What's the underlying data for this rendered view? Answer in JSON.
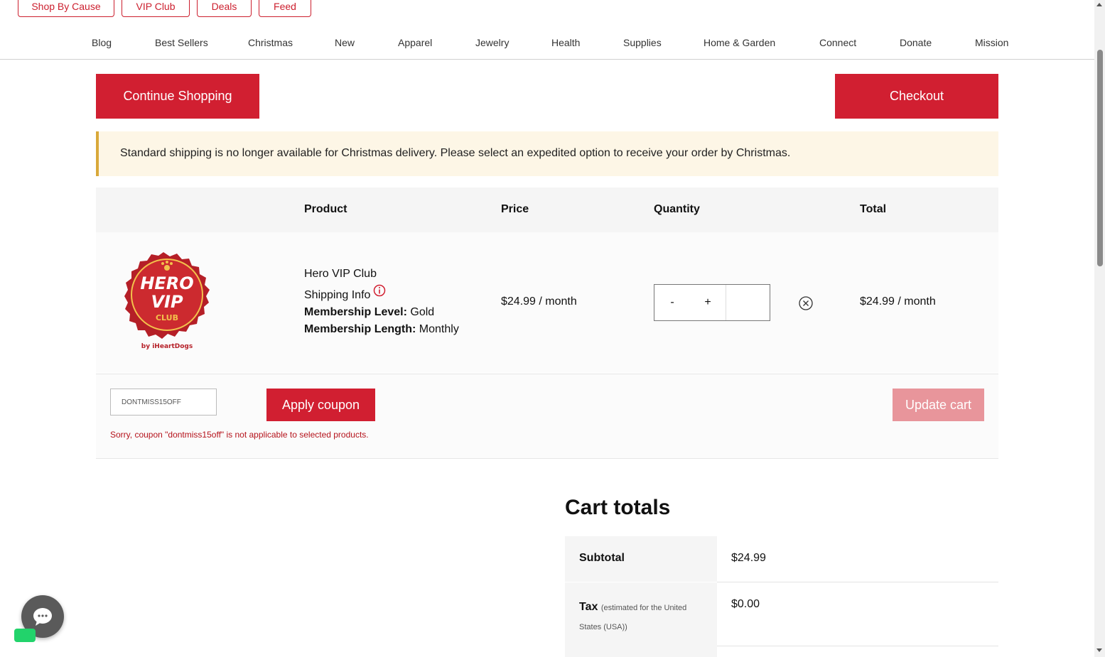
{
  "top_pills": [
    "Shop By Cause",
    "VIP Club",
    "Deals",
    "Feed"
  ],
  "nav_items": [
    "Blog",
    "Best Sellers",
    "Christmas",
    "New",
    "Apparel",
    "Jewelry",
    "Health",
    "Supplies",
    "Home & Garden",
    "Connect",
    "Donate",
    "Mission"
  ],
  "actions": {
    "continue": "Continue Shopping",
    "checkout": "Checkout"
  },
  "notice": "Standard shipping is no longer available for Christmas delivery. Please select an expedited option to receive your order by Christmas.",
  "table_headers": {
    "product": "Product",
    "price": "Price",
    "quantity": "Quantity",
    "total": "Total"
  },
  "product": {
    "name": "Hero VIP Club",
    "shipping_info": "Shipping Info",
    "level_label": "Membership Level:",
    "level_value": "Gold",
    "length_label": "Membership Length:",
    "length_value": "Monthly",
    "price": "$24.99 / month",
    "qty_minus": "-",
    "qty_plus": "+",
    "qty_value": "",
    "total": "$24.99 / month",
    "logo": {
      "line1": "HERO",
      "line2": "VIP",
      "line3": "CLUB",
      "byline": "by iHeartDogs"
    }
  },
  "coupon": {
    "value": "DONTMISS15OFF",
    "apply_label": "Apply coupon",
    "update_label": "Update cart",
    "error": "Sorry, coupon \"dontmiss15off\" is not applicable to selected products."
  },
  "totals": {
    "title": "Cart totals",
    "subtotal_label": "Subtotal",
    "subtotal_value": "$24.99",
    "tax_label": "Tax",
    "tax_note": "(estimated for the United States (USA))",
    "tax_value": "$0.00"
  },
  "colors": {
    "brand_red": "#d11f31",
    "faded_red": "#e8959b",
    "notice_bg": "#fdf6e6",
    "notice_border": "#d9a93a"
  }
}
